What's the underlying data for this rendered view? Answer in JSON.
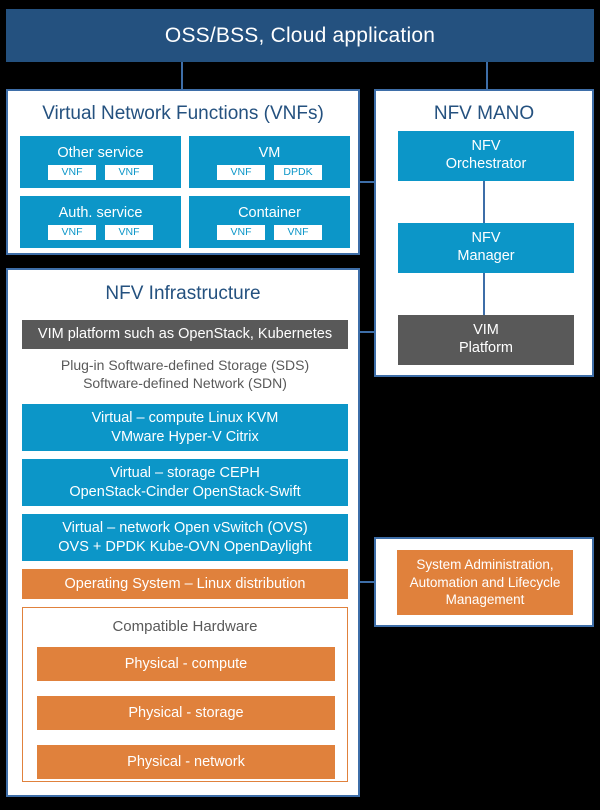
{
  "header": {
    "title": "OSS/BSS, Cloud application"
  },
  "vnf_panel": {
    "title": "Virtual Network Functions (VNFs)",
    "cards": [
      {
        "title": "Other service",
        "chips": [
          "VNF",
          "VNF"
        ]
      },
      {
        "title": "VM",
        "chips": [
          "VNF",
          "DPDK"
        ]
      },
      {
        "title": "Auth. service",
        "chips": [
          "VNF",
          "VNF"
        ]
      },
      {
        "title": "Container",
        "chips": [
          "VNF",
          "VNF"
        ]
      }
    ]
  },
  "mano_panel": {
    "title": "NFV MANO",
    "boxes": [
      {
        "line1": "NFV",
        "line2": "Orchestrator",
        "color": "#0C96C8"
      },
      {
        "line1": "NFV",
        "line2": "Manager",
        "color": "#0C96C8"
      },
      {
        "line1": "VIM",
        "line2": "Platform",
        "color": "#595959"
      }
    ]
  },
  "infra_panel": {
    "title": "NFV Infrastructure",
    "vim_bar": "VIM platform such as OpenStack, Kubernetes",
    "plugin_note_line1": "Plug-in Software-defined Storage (SDS)",
    "plugin_note_line2": "Software-defined Network (SDN)",
    "virtual_compute_line1": "Virtual – compute Linux KVM",
    "virtual_compute_line2": "VMware Hyper-V Citrix",
    "virtual_storage_line1": "Virtual –  storage CEPH",
    "virtual_storage_line2": "OpenStack-Cinder OpenStack-Swift",
    "virtual_network_line1": "Virtual –  network Open vSwitch (OVS)",
    "virtual_network_line2": "OVS + DPDK Kube-OVN OpenDaylight",
    "operating_system": "Operating System – Linux distribution",
    "hardware": {
      "title": "Compatible Hardware",
      "bars": [
        "Physical - compute",
        "Physical - storage",
        "Physical - network"
      ]
    }
  },
  "sysadmin_panel": {
    "text": "System Administration, Automation and Lifecycle Management"
  },
  "colors": {
    "background": "#000000",
    "header_blue": "#24517F",
    "panel_border": "#3E6EA8",
    "accent_cyan": "#0C96C8",
    "accent_orange": "#E0813C",
    "grey": "#595959",
    "panel_fill": "#FFFFFF",
    "connector": "#3E6EA8"
  }
}
